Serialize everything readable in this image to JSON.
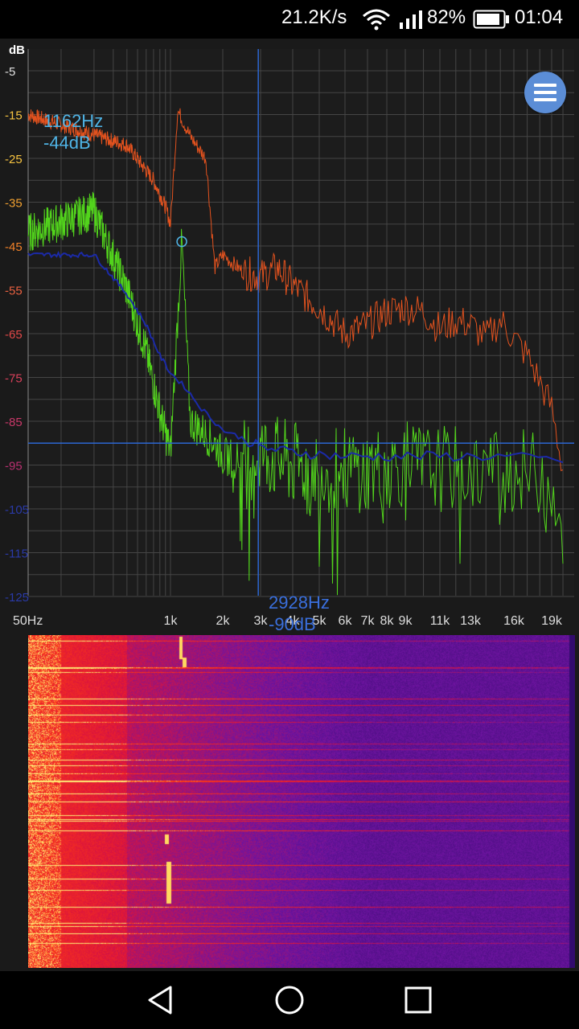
{
  "status_bar": {
    "network_speed": "21.2K/s",
    "battery_percent": "82%",
    "time": "01:04",
    "icons": [
      "wifi-icon",
      "signal-icon",
      "battery-icon"
    ]
  },
  "spectrum": {
    "y_unit_label": "dB",
    "y_ticks": [
      "-5",
      "-15",
      "-25",
      "-35",
      "-45",
      "-55",
      "-65",
      "-75",
      "-85",
      "-95",
      "-105",
      "-115",
      "-125"
    ],
    "x_ticks": [
      "50Hz",
      "1k",
      "2k",
      "3k",
      "4k",
      "5k",
      "6k",
      "7k",
      "8k",
      "9k",
      "11k",
      "13k",
      "16k",
      "19k"
    ],
    "peak_readout": {
      "freq": "1162Hz",
      "level": "-44dB"
    },
    "cursor_readout": {
      "freq": "2928Hz",
      "level": "-90dB"
    },
    "colors": {
      "orange": "#e3521e",
      "green": "#52d41c",
      "blue": "#1b2aa8",
      "cursor": "#2c66d1",
      "grid": "#454545"
    }
  },
  "menu_button": {
    "icon": "menu-icon"
  },
  "nav_bar": {
    "icons": [
      "back-icon",
      "home-icon",
      "recents-icon"
    ]
  },
  "chart_data": {
    "type": "line",
    "title": "",
    "xlabel": "",
    "ylabel": "dB",
    "ylim": [
      -125,
      -5
    ],
    "x_ticks": [
      "50Hz",
      "1k",
      "2k",
      "3k",
      "4k",
      "5k",
      "6k",
      "7k",
      "8k",
      "9k",
      "11k",
      "13k",
      "16k",
      "19k"
    ],
    "series": [
      {
        "color": "#e3521e",
        "x": [
          50,
          400,
          700,
          900,
          1000,
          1100,
          1300,
          1600,
          1800,
          2000,
          2500,
          3000,
          3500,
          4000,
          5000,
          6000,
          7000,
          8000,
          9000,
          10000,
          11000,
          12000,
          13000,
          14000,
          15000,
          16000,
          17000,
          18000,
          19000,
          20000
        ],
        "y": [
          -15,
          -22,
          -30,
          -36,
          -40,
          -14,
          -20,
          -25,
          -50,
          -47,
          -51,
          -52,
          -50,
          -54,
          -59,
          -65,
          -63,
          -60,
          -59,
          -60,
          -64,
          -62,
          -63,
          -66,
          -62,
          -66,
          -70,
          -76,
          -82,
          -96
        ]
      },
      {
        "color": "#52d41c",
        "x": [
          50,
          200,
          400,
          600,
          800,
          1000,
          1162,
          1300,
          1500,
          1800,
          2000,
          2500,
          3000,
          4000,
          5000,
          7000,
          9000,
          12000,
          15000,
          18000,
          19000,
          20000
        ],
        "y": [
          -42,
          -37,
          -55,
          -69,
          -83,
          -92,
          -44,
          -85,
          -87,
          -90,
          -93,
          -94,
          -92,
          -95,
          -96,
          -96,
          -95,
          -96,
          -96,
          -97,
          -98,
          -110
        ]
      },
      {
        "color": "#1b2aa8",
        "x": [
          50,
          200,
          400,
          600,
          800,
          1000,
          1200,
          1500,
          2000,
          2500,
          3000,
          4000,
          6000,
          10000,
          15000,
          20000
        ],
        "y": [
          -47,
          -47,
          -56,
          -63,
          -70,
          -74,
          -77,
          -82,
          -87,
          -89,
          -91,
          -92,
          -93,
          -93,
          -93,
          -94
        ]
      }
    ],
    "cursor": {
      "x": 2928,
      "y": -90
    },
    "peak": {
      "x": 1162,
      "y": -44
    }
  }
}
